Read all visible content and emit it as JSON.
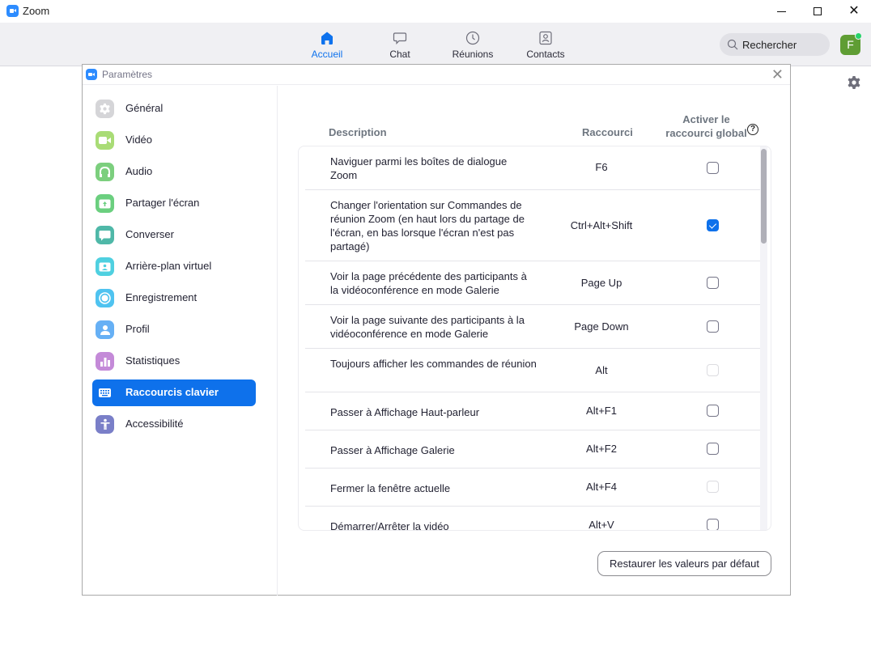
{
  "app": {
    "title": "Zoom",
    "icon": "zoom-camera-icon"
  },
  "window_controls": {
    "minimize": "minimize-icon",
    "maximize": "maximize-icon",
    "close": "close-icon"
  },
  "topnav": {
    "tabs": [
      {
        "label": "Accueil",
        "icon": "home-icon",
        "active": true
      },
      {
        "label": "Chat",
        "icon": "chat-bubble-icon",
        "active": false
      },
      {
        "label": "Réunions",
        "icon": "clock-icon",
        "active": false
      },
      {
        "label": "Contacts",
        "icon": "contact-card-icon",
        "active": false
      }
    ],
    "search_label": "Rechercher",
    "avatar_initial": "F",
    "avatar_status": "online",
    "accent_color": "#0e72ed"
  },
  "dialog": {
    "title": "Paramètres",
    "sidebar": [
      {
        "label": "Général",
        "icon": "gear-icon",
        "color": "#d5d5d8",
        "active": false
      },
      {
        "label": "Vidéo",
        "icon": "video-camera-icon",
        "color": "#a9dc76",
        "active": false
      },
      {
        "label": "Audio",
        "icon": "headphones-icon",
        "color": "#7ccf7e",
        "active": false
      },
      {
        "label": "Partager l'écran",
        "icon": "share-screen-icon",
        "color": "#6bcf7f",
        "active": false
      },
      {
        "label": "Converser",
        "icon": "chat-bubble-icon",
        "color": "#4fb8a8",
        "active": false
      },
      {
        "label": "Arrière-plan virtuel",
        "icon": "virtual-background-icon",
        "color": "#4fd0e0",
        "active": false
      },
      {
        "label": "Enregistrement",
        "icon": "record-icon",
        "color": "#4fc3f0",
        "active": false
      },
      {
        "label": "Profil",
        "icon": "profile-icon",
        "color": "#66b0f5",
        "active": false
      },
      {
        "label": "Statistiques",
        "icon": "bar-chart-icon",
        "color": "#c48ad8",
        "active": false
      },
      {
        "label": "Raccourcis clavier",
        "icon": "keyboard-icon",
        "color": "#0e71eb",
        "active": true
      },
      {
        "label": "Accessibilité",
        "icon": "accessibility-icon",
        "color": "#7a7fc8",
        "active": false
      }
    ],
    "shortcuts": {
      "headers": {
        "description": "Description",
        "shortcut": "Raccourci",
        "global_line1": "Activer le",
        "global_line2": "raccourci global"
      },
      "rows": [
        {
          "description": "Naviguer parmi les boîtes de dialogue Zoom",
          "shortcut": "F6",
          "global": "unchecked"
        },
        {
          "description": "Changer l'orientation sur Commandes de réunion Zoom (en haut lors du partage de l'écran, en bas lorsque l'écran n'est pas partagé)",
          "shortcut": "Ctrl+Alt+Shift",
          "global": "checked"
        },
        {
          "description": "Voir la page précédente des participants à la vidéoconférence en mode Galerie",
          "shortcut": "Page Up",
          "global": "unchecked"
        },
        {
          "description": "Voir la page suivante des participants à la vidéoconférence en mode Galerie",
          "shortcut": "Page Down",
          "global": "unchecked"
        },
        {
          "description": "Toujours afficher les commandes de réunion",
          "shortcut": "Alt",
          "global": "disabled"
        },
        {
          "description": "Passer à Affichage Haut-parleur",
          "shortcut": "Alt+F1",
          "global": "unchecked"
        },
        {
          "description": "Passer à Affichage Galerie",
          "shortcut": "Alt+F2",
          "global": "unchecked"
        },
        {
          "description": "Fermer la fenêtre actuelle",
          "shortcut": "Alt+F4",
          "global": "disabled"
        },
        {
          "description": "Démarrer/Arrêter la vidéo",
          "shortcut": "Alt+V",
          "global": "unchecked"
        }
      ]
    },
    "restore_button": "Restaurer les valeurs par défaut"
  }
}
